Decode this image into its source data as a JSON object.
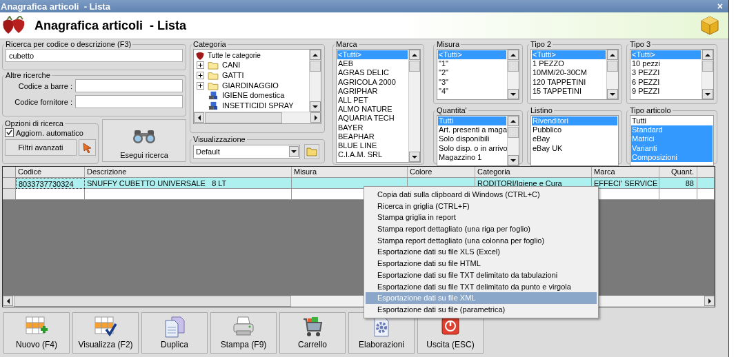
{
  "window": {
    "title": "Anagrafica articoli  - Lista",
    "close": "×"
  },
  "header": {
    "title": "Anagrafica articoli  - Lista"
  },
  "search": {
    "label": "Ricerca per codice o descrizione (F3)",
    "value": "cubetto"
  },
  "other_search": {
    "label": "Altre ricerche",
    "fields": [
      {
        "label": "Codice a barre :"
      },
      {
        "label": "Codice fornitore :"
      }
    ]
  },
  "options": {
    "label": "Opzioni di ricerca",
    "auto_update": {
      "label": "Aggiorn. automatico",
      "checked": true
    },
    "advanced_button": "Filtri avanzati"
  },
  "run_button": "Esegui ricerca",
  "categoria": {
    "label": "Categoria",
    "root": {
      "label": "Tutte le categorie",
      "children": [
        {
          "label": "CANI",
          "kind": "folder",
          "expanded": false
        },
        {
          "label": "GATTI",
          "kind": "folder",
          "expanded": false
        },
        {
          "label": "GIARDINAGGIO",
          "kind": "folder",
          "expanded": false
        },
        {
          "label": "IGIENE domestica",
          "kind": "item"
        },
        {
          "label": "INSETTICIDI SPRAY",
          "kind": "item"
        }
      ]
    }
  },
  "visualizzazione": {
    "label": "Visualizzazione",
    "value": "Default"
  },
  "marca": {
    "label": "Marca",
    "items": [
      {
        "text": "<Tutti>",
        "selected": true
      },
      {
        "text": "AEB",
        "selected": false
      },
      {
        "text": "AGRAS DELIC",
        "selected": false
      },
      {
        "text": "AGRICOLA 2000",
        "selected": false
      },
      {
        "text": "AGRIPHAR",
        "selected": false
      },
      {
        "text": "ALL PET",
        "selected": false
      },
      {
        "text": "ALMO NATURE",
        "selected": false
      },
      {
        "text": "AQUARIA TECH",
        "selected": false
      },
      {
        "text": "BAYER",
        "selected": false
      },
      {
        "text": "BEAPHAR",
        "selected": false
      },
      {
        "text": "BLUE LINE",
        "selected": false
      },
      {
        "text": "C.I.A.M. SRL",
        "selected": false
      }
    ]
  },
  "misura": {
    "label": "Misura",
    "items": [
      {
        "text": "<Tutti>",
        "selected": true
      },
      {
        "text": "\"1\"",
        "selected": false
      },
      {
        "text": "\"2\"",
        "selected": false
      },
      {
        "text": "\"3\"",
        "selected": false
      },
      {
        "text": "\"4\"",
        "selected": false
      }
    ]
  },
  "tipo_2": {
    "label": "Tipo 2",
    "items": [
      {
        "text": "<Tutti>",
        "selected": true
      },
      {
        "text": "1 PEZZO",
        "selected": false
      },
      {
        "text": "10MM/20-30CM",
        "selected": false
      },
      {
        "text": "120 TAPPETINI",
        "selected": false
      },
      {
        "text": "15 TAPPETINI",
        "selected": false
      }
    ]
  },
  "tipo_3": {
    "label": "Tipo 3",
    "items": [
      {
        "text": "<Tutti>",
        "selected": true
      },
      {
        "text": "10 pezzi",
        "selected": false
      },
      {
        "text": "3 PEZZI",
        "selected": false
      },
      {
        "text": "6 PEZZI",
        "selected": false
      },
      {
        "text": "9 PEZZI",
        "selected": false
      }
    ]
  },
  "quantita": {
    "label": "Quantita'",
    "items": [
      {
        "text": "Tutti",
        "selected": true
      },
      {
        "text": "Art. presenti a maga",
        "selected": false
      },
      {
        "text": "Solo disponibili",
        "selected": false
      },
      {
        "text": "Solo disp. o in arrivo",
        "selected": false
      },
      {
        "text": "Magazzino 1",
        "selected": false
      }
    ]
  },
  "listino": {
    "label": "Listino",
    "items": [
      {
        "text": "Rivenditori",
        "selected": true
      },
      {
        "text": "Pubblico",
        "selected": false
      },
      {
        "text": "eBay",
        "selected": false
      },
      {
        "text": "eBay UK",
        "selected": false
      }
    ]
  },
  "tipo_articolo": {
    "label": "Tipo articolo",
    "items": [
      {
        "text": "Tutti",
        "selected": false
      },
      {
        "text": "Standard",
        "selected": true
      },
      {
        "text": "Matrici",
        "selected": true
      },
      {
        "text": "Varianti",
        "selected": true
      },
      {
        "text": "Composizioni",
        "selected": true
      }
    ]
  },
  "table": {
    "columns": [
      "Codice",
      "Descrizione",
      "Misura",
      "Colore",
      "Categoria",
      "Marca",
      "Quant."
    ],
    "rows": [
      {
        "cells": [
          "8033737730324",
          "SNUFFY CUBETTO UNIVERSALE   8 LT",
          "",
          "",
          "RODITORI/Igiene e Cura",
          "EFFECI' SERVICE",
          "88"
        ],
        "selected": true
      }
    ]
  },
  "context_menu": [
    {
      "label": "Copia dati sulla clipboard di Windows (CTRL+C)",
      "selected": false
    },
    {
      "label": "Ricerca in griglia (CTRL+F)",
      "selected": false
    },
    {
      "label": "Stampa griglia in report",
      "selected": false
    },
    {
      "label": "Stampa report dettagliato (una riga per foglio)",
      "selected": false
    },
    {
      "label": "Stampa report dettagliato (una colonna per foglio)",
      "selected": false
    },
    {
      "label": "Esportazione dati su file XLS (Excel)",
      "selected": false
    },
    {
      "label": "Esportazione dati su file HTML",
      "selected": false
    },
    {
      "label": "Esportazione dati su file TXT delimitato da tabulazioni",
      "selected": false
    },
    {
      "label": "Esportazione dati su file TXT delimitato da punto e virgola",
      "selected": false
    },
    {
      "label": "Esportazione dati su file XML",
      "selected": true
    },
    {
      "label": "Esportazione dati su file (parametrica)",
      "selected": false
    }
  ],
  "toolbar": [
    {
      "label": "Nuovo (F4)",
      "kind": "new"
    },
    {
      "label": "Visualizza (F2)",
      "kind": "view"
    },
    {
      "label": "Duplica",
      "kind": "duplicate"
    },
    {
      "label": "Stampa (F9)",
      "kind": "print"
    },
    {
      "label": "Carrello",
      "kind": "cart"
    },
    {
      "label": "Elaborazioni",
      "kind": "process"
    },
    {
      "label": "Uscita (ESC)",
      "kind": "exit"
    }
  ]
}
